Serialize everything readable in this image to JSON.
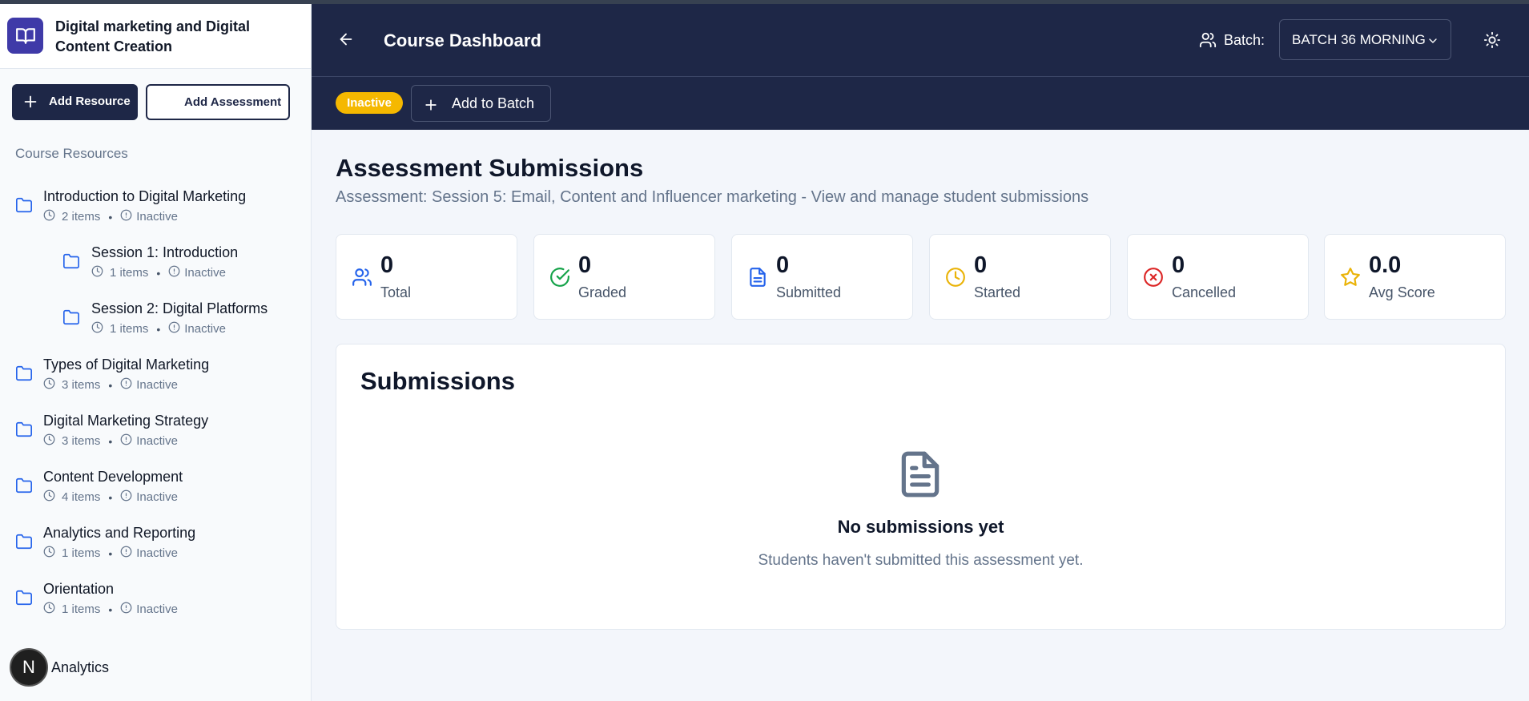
{
  "sidebar": {
    "course_title": "Digital marketing and Digital Content Creation",
    "add_resource_label": "Add Resource",
    "add_assessment_label": "Add Assessment",
    "section_label": "Course Resources",
    "items": [
      {
        "title": "Introduction to Digital Marketing",
        "count": "2 items",
        "status": "Inactive",
        "level": 0
      },
      {
        "title": "Session 1: Introduction",
        "count": "1 items",
        "status": "Inactive",
        "level": 1
      },
      {
        "title": "Session 2: Digital Platforms",
        "count": "1 items",
        "status": "Inactive",
        "level": 1
      },
      {
        "title": "Types of Digital Marketing",
        "count": "3 items",
        "status": "Inactive",
        "level": 0
      },
      {
        "title": "Digital Marketing Strategy",
        "count": "3 items",
        "status": "Inactive",
        "level": 0
      },
      {
        "title": "Content Development",
        "count": "4 items",
        "status": "Inactive",
        "level": 0
      },
      {
        "title": "Analytics and Reporting",
        "count": "1 items",
        "status": "Inactive",
        "level": 0
      },
      {
        "title": "Orientation",
        "count": "1 items",
        "status": "Inactive",
        "level": 0
      }
    ],
    "footer_badge": "N",
    "footer_label": "Analytics"
  },
  "header": {
    "title": "Course Dashboard",
    "batch_label": "Batch:",
    "batch_value": "BATCH 36 MORNING",
    "status_badge": "Inactive",
    "add_to_batch_label": "Add to Batch"
  },
  "main": {
    "title": "Assessment Submissions",
    "subtitle": "Assessment: Session 5: Email, Content and Influencer marketing - View and manage student submissions",
    "stats": [
      {
        "value": "0",
        "label": "Total",
        "icon": "users-icon",
        "color": "#2563eb"
      },
      {
        "value": "0",
        "label": "Graded",
        "icon": "check-circle-icon",
        "color": "#16a34a"
      },
      {
        "value": "0",
        "label": "Submitted",
        "icon": "file-text-icon",
        "color": "#2563eb"
      },
      {
        "value": "0",
        "label": "Started",
        "icon": "clock-icon",
        "color": "#eab308"
      },
      {
        "value": "0",
        "label": "Cancelled",
        "icon": "x-circle-icon",
        "color": "#dc2626"
      },
      {
        "value": "0.0",
        "label": "Avg Score",
        "icon": "star-icon",
        "color": "#eab308"
      }
    ],
    "submissions": {
      "title": "Submissions",
      "empty_title": "No submissions yet",
      "empty_desc": "Students haven't submitted this assessment yet."
    }
  },
  "colors": {
    "navy": "#1e2747",
    "accent_purple": "#3f3aa8",
    "badge_yellow": "#f5b800",
    "folder_blue": "#2563eb"
  }
}
